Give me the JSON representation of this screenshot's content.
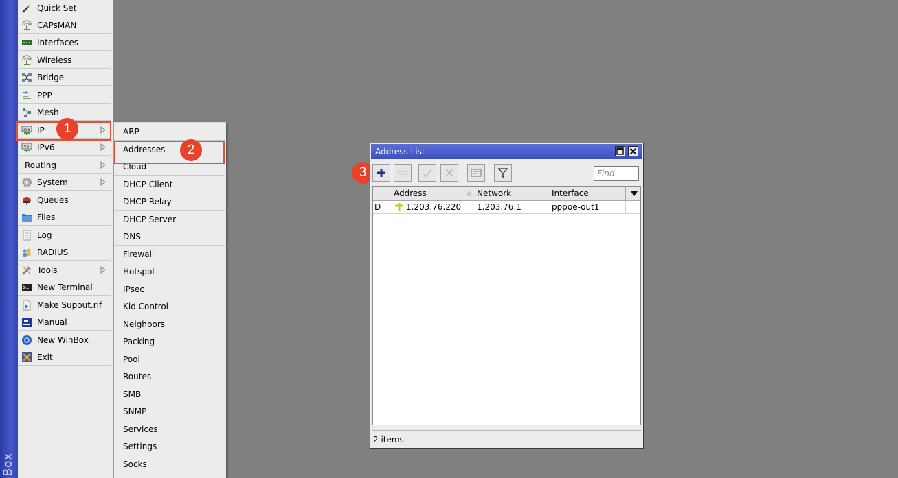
{
  "brand": {
    "text": "Box"
  },
  "main_menu": {
    "items": [
      {
        "label": "Quick Set",
        "icon": "wand-icon",
        "arrow": false
      },
      {
        "label": "CAPsMAN",
        "icon": "antenna-icon",
        "arrow": false
      },
      {
        "label": "Interfaces",
        "icon": "interfaces-icon",
        "arrow": false
      },
      {
        "label": "Wireless",
        "icon": "wireless-icon",
        "arrow": false
      },
      {
        "label": "Bridge",
        "icon": "bridge-icon",
        "arrow": false
      },
      {
        "label": "PPP",
        "icon": "ppp-icon",
        "arrow": false
      },
      {
        "label": "Mesh",
        "icon": "mesh-icon",
        "arrow": false
      },
      {
        "label": "IP",
        "icon": "ip-icon",
        "arrow": true
      },
      {
        "label": "IPv6",
        "icon": "ipv6-icon",
        "arrow": true
      },
      {
        "label": "Routing",
        "icon": "",
        "arrow": true
      },
      {
        "label": "System",
        "icon": "gear-icon",
        "arrow": true
      },
      {
        "label": "Queues",
        "icon": "queues-icon",
        "arrow": false
      },
      {
        "label": "Files",
        "icon": "folder-icon",
        "arrow": false
      },
      {
        "label": "Log",
        "icon": "log-icon",
        "arrow": false
      },
      {
        "label": "RADIUS",
        "icon": "users-icon",
        "arrow": false
      },
      {
        "label": "Tools",
        "icon": "tools-icon",
        "arrow": true
      },
      {
        "label": "New Terminal",
        "icon": "terminal-icon",
        "arrow": false
      },
      {
        "label": "Make Supout.rif",
        "icon": "supout-icon",
        "arrow": false
      },
      {
        "label": "Manual",
        "icon": "manual-icon",
        "arrow": false
      },
      {
        "label": "New WinBox",
        "icon": "winbox-icon",
        "arrow": false
      },
      {
        "label": "Exit",
        "icon": "exit-icon",
        "arrow": false
      }
    ]
  },
  "sub_menu": {
    "items": [
      "ARP",
      "Addresses",
      "Cloud",
      "DHCP Client",
      "DHCP Relay",
      "DHCP Server",
      "DNS",
      "Firewall",
      "Hotspot",
      "IPsec",
      "Kid Control",
      "Neighbors",
      "Packing",
      "Pool",
      "Routes",
      "SMB",
      "SNMP",
      "Services",
      "Settings",
      "Socks"
    ]
  },
  "badges": [
    "1",
    "2",
    "3"
  ],
  "window": {
    "title": "Address List",
    "find_placeholder": "Find",
    "columns": [
      "Address",
      "Network",
      "Interface"
    ],
    "rows": [
      {
        "flag": "D",
        "address": "1.203.76.220",
        "network": "1.203.76.1",
        "interface": "pppoe-out1"
      }
    ],
    "status": "2 items"
  },
  "colors": {
    "highlight": "#e0523a",
    "badge": "#e8412c",
    "titlebar": "#4656c8",
    "brand_bar": "#3546b6"
  }
}
